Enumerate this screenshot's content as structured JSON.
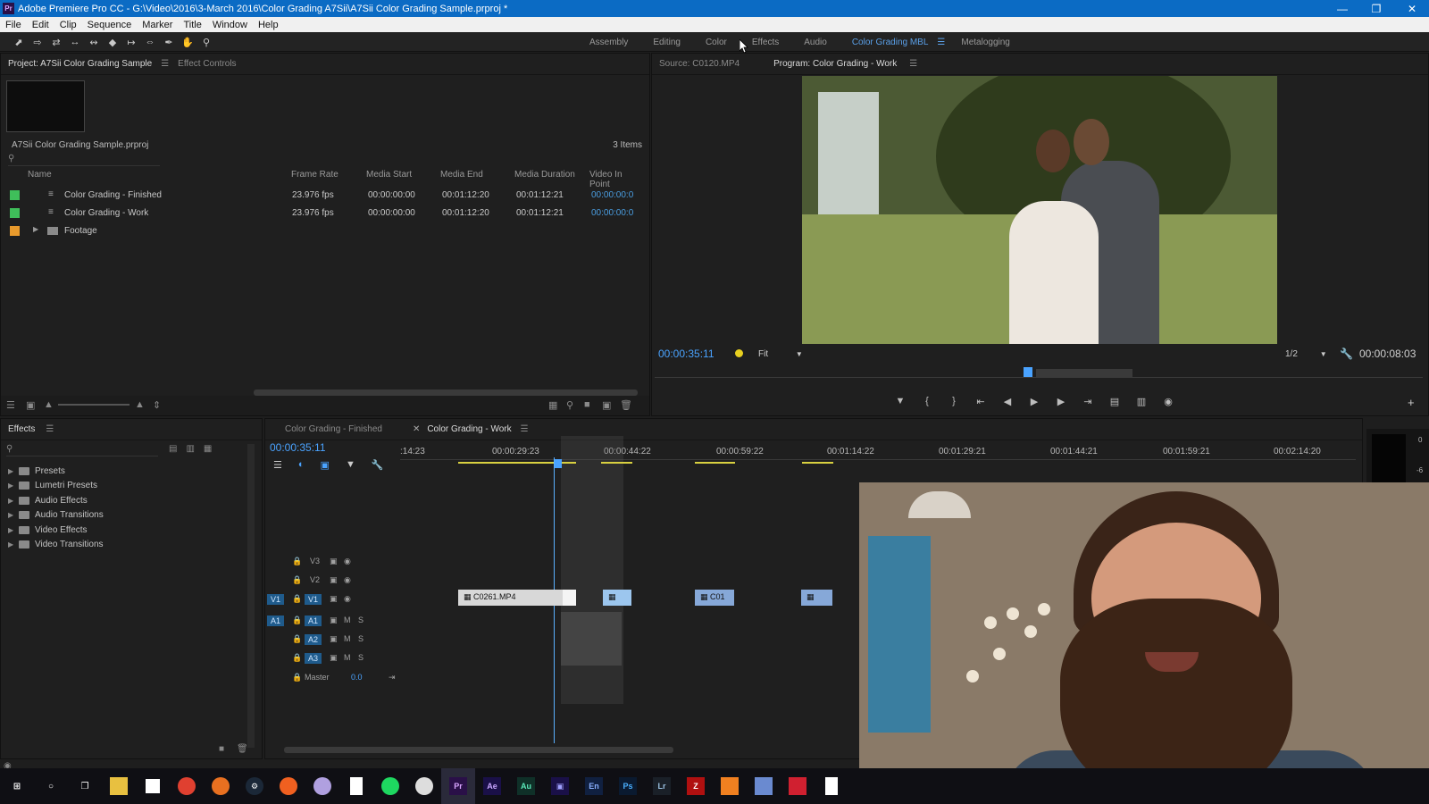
{
  "app": {
    "title": "Adobe Premiere Pro CC - G:\\Video\\2016\\3-March 2016\\Color Grading A7Sii\\A7Sii Color Grading Sample.prproj *",
    "logo_text": "Pr"
  },
  "menu": [
    "File",
    "Edit",
    "Clip",
    "Sequence",
    "Marker",
    "Title",
    "Window",
    "Help"
  ],
  "workspaces": {
    "items": [
      "Assembly",
      "Editing",
      "Color",
      "Effects",
      "Audio"
    ],
    "active": "Color Grading MBL",
    "after": "Metalogging"
  },
  "project": {
    "tab_active": "Project: A7Sii Color Grading Sample",
    "tab_other": "Effect Controls",
    "file_name": "A7Sii Color Grading Sample.prproj",
    "item_count": "3 Items",
    "columns": [
      "Name",
      "Frame Rate",
      "Media Start",
      "Media End",
      "Media Duration",
      "Video In Point"
    ],
    "rows": [
      {
        "name": "Color Grading - Finished",
        "fps": "23.976 fps",
        "start": "00:00:00:00",
        "end": "00:01:12:20",
        "duration": "00:01:12:21",
        "inpoint": "00:00:00:0",
        "label_color": "#3fbf5a"
      },
      {
        "name": "Color Grading - Work",
        "fps": "23.976 fps",
        "start": "00:00:00:00",
        "end": "00:01:12:20",
        "duration": "00:01:12:21",
        "inpoint": "00:00:00:0",
        "label_color": "#3fbf5a"
      },
      {
        "name": "Footage",
        "fps": "",
        "start": "",
        "end": "",
        "duration": "",
        "inpoint": "",
        "label_color": "#e89a2c"
      }
    ]
  },
  "monitor": {
    "source_tab": "Source: C0120.MP4",
    "program_tab": "Program: Color Grading - Work",
    "timecode": "00:00:35:11",
    "fit": "Fit",
    "resolution": "1/2",
    "duration": "00:00:08:03"
  },
  "effects": {
    "tab": "Effects",
    "items": [
      "Presets",
      "Lumetri Presets",
      "Audio Effects",
      "Audio Transitions",
      "Video Effects",
      "Video Transitions"
    ]
  },
  "timeline": {
    "tab_finished": "Color Grading - Finished",
    "tab_work": "Color Grading - Work",
    "timecode": "00:00:35:11",
    "ruler": [
      ":14:23",
      "00:00:29:23",
      "00:00:44:22",
      "00:00:59:22",
      "00:01:14:22",
      "00:01:29:21",
      "00:01:44:21",
      "00:01:59:21",
      "00:02:14:20"
    ],
    "tracks": {
      "v3": "V3",
      "v2": "V2",
      "v1": "V1",
      "a1": "A1",
      "a2": "A2",
      "a3": "A3",
      "src_v1": "V1",
      "src_a1": "A1",
      "mute": "M",
      "solo": "S",
      "master": "Master",
      "master_value": "0.0"
    },
    "clips": {
      "c1": "C0261.MP4",
      "c3": "C01"
    }
  },
  "colors": {
    "accent": "#4aa3ff",
    "titlebar": "#0b6bc4"
  }
}
